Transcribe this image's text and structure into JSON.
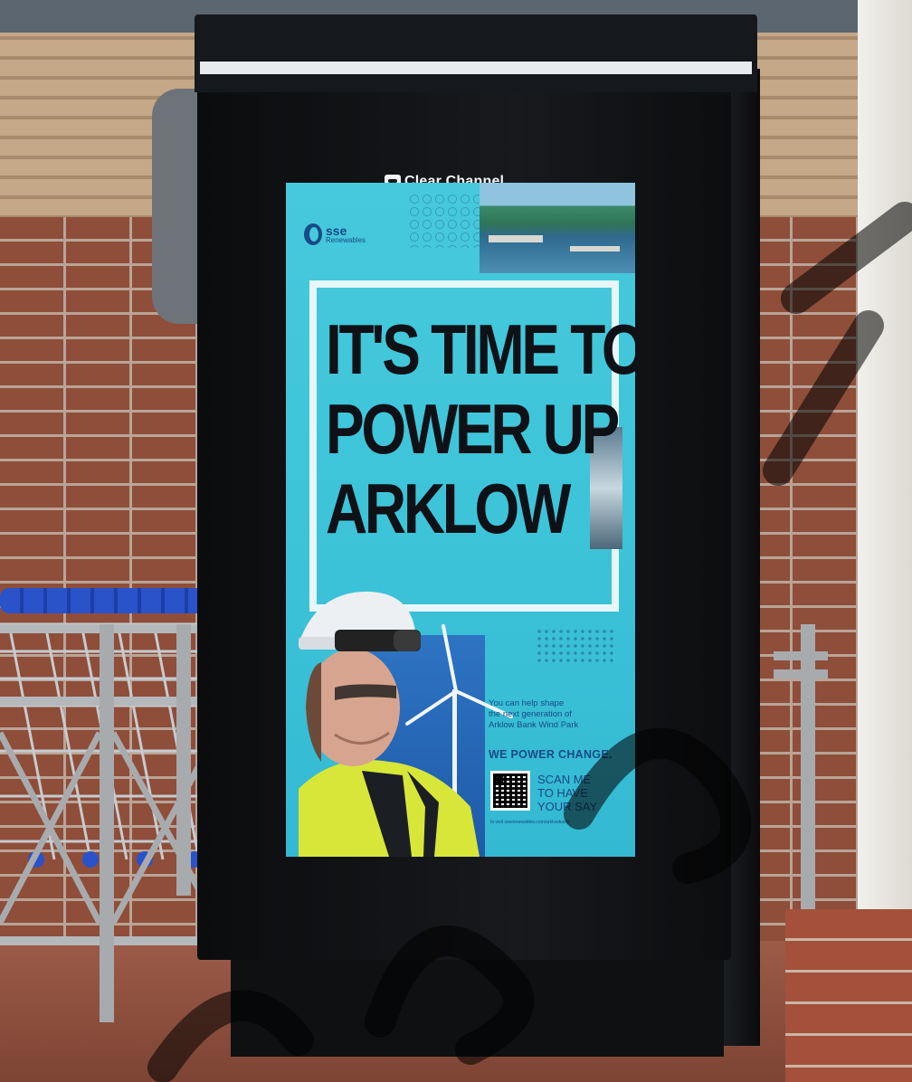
{
  "scene": {
    "description_label": "digital advertising totem outside a shop"
  },
  "totem": {
    "brand": "Clear Channel"
  },
  "ad": {
    "sponsor_name": "sse",
    "sponsor_sub": "Renewables",
    "headline": [
      "IT'S TIME TO",
      "POWER UP",
      "ARKLOW"
    ],
    "body_lines": [
      "You can help shape",
      "the next generation of",
      "Arklow Bank Wind Park"
    ],
    "tagline": "WE POWER CHANGE.",
    "cta_lines": [
      "SCAN ME",
      "TO HAVE",
      "YOUR SAY"
    ],
    "url": "to visit sserenewables.com/arklowbank/"
  },
  "colors": {
    "screen_bg": "#3dc4d9",
    "brand_navy": "#174a86",
    "headline_ink": "#0e1116",
    "totem_black": "#15181c"
  }
}
